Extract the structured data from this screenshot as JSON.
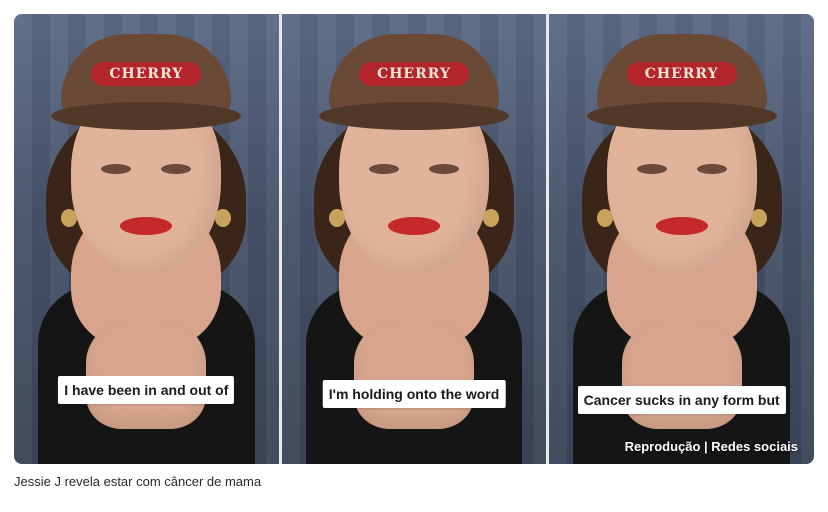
{
  "panels": [
    {
      "caption": "I have been in and out of",
      "cap_text": "CHERRY"
    },
    {
      "caption": "I'm holding onto the word",
      "cap_text": "CHERRY"
    },
    {
      "caption": "Cancer sucks in any form but",
      "cap_text": "CHERRY"
    }
  ],
  "credit": "Reprodução | Redes sociais",
  "figcaption": "Jessie J revela estar com câncer de mama",
  "colors": {
    "background": "#ffffff",
    "caption_box": "#ffffff",
    "lips": "#c52a2a"
  }
}
